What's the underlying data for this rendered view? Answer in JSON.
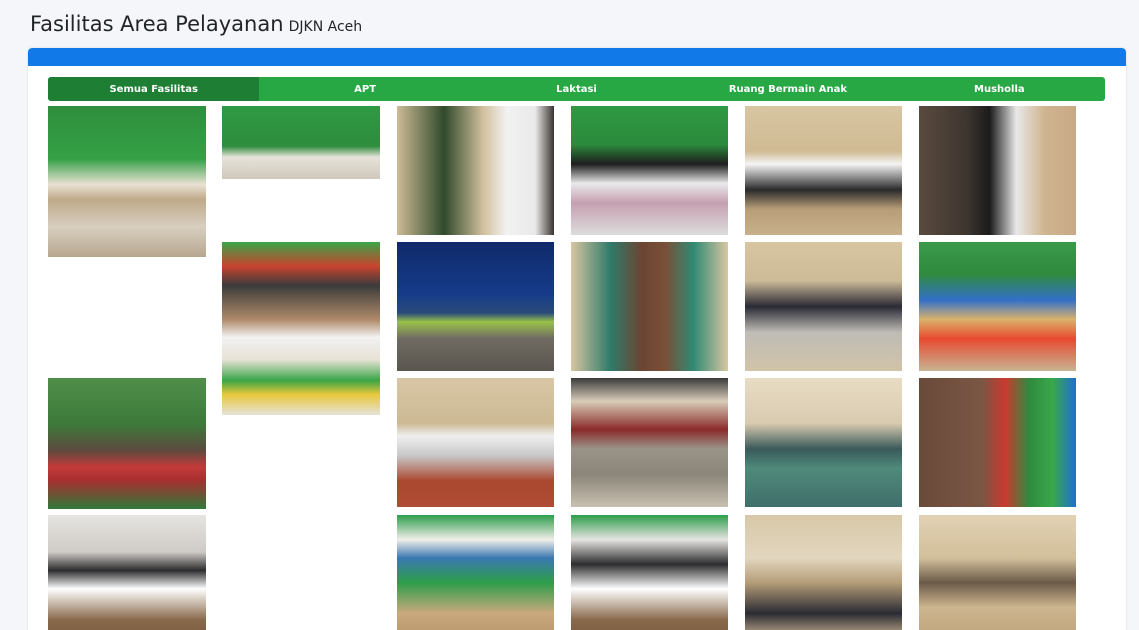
{
  "header": {
    "title": "Fasilitas Area Pelayanan",
    "subtitle": "DJKN Aceh"
  },
  "tabs": [
    {
      "label": "Semua Fasilitas",
      "active": true
    },
    {
      "label": "APT",
      "active": false
    },
    {
      "label": "Laktasi",
      "active": false
    },
    {
      "label": "Ruang Bermain Anak",
      "active": false
    },
    {
      "label": "Musholla",
      "active": false
    }
  ],
  "colors": {
    "accent": "#1279e9",
    "tab_bar": "#28a745",
    "tab_active": "#1e7e34"
  }
}
